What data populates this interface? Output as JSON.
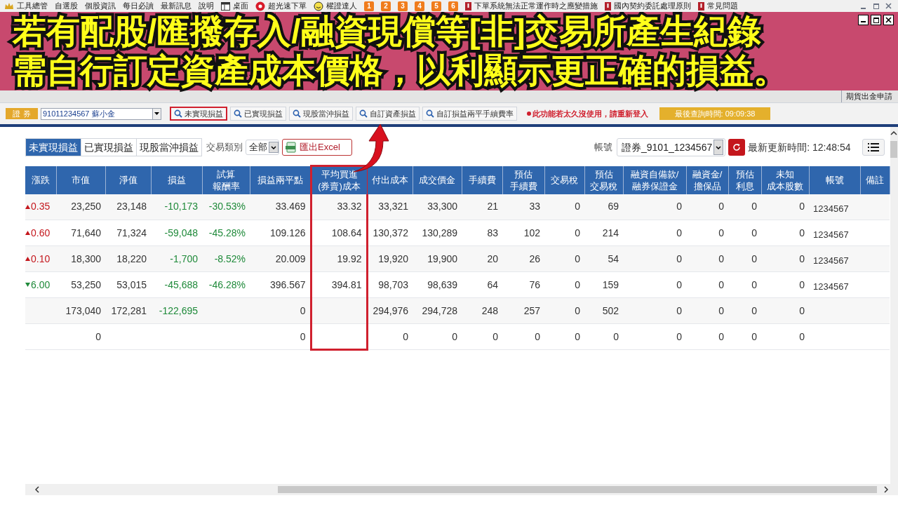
{
  "menu_bar": {
    "items": [
      {
        "label": "工具總管",
        "kind": "crown"
      },
      {
        "label": "自選股",
        "kind": "text"
      },
      {
        "label": "個股資訊",
        "kind": "text"
      },
      {
        "label": "每日必讀",
        "kind": "text"
      },
      {
        "label": "最新訊息",
        "kind": "text"
      },
      {
        "label": "說明",
        "kind": "text"
      },
      {
        "label": "桌面",
        "kind": "window"
      },
      {
        "label": "超光速下單",
        "kind": "burst"
      },
      {
        "label": "權證達人",
        "kind": "smiley"
      },
      {
        "label": "1",
        "kind": "tile"
      },
      {
        "label": "2",
        "kind": "tile"
      },
      {
        "label": "3",
        "kind": "tile"
      },
      {
        "label": "4",
        "kind": "tile"
      },
      {
        "label": "5",
        "kind": "tile"
      },
      {
        "label": "6",
        "kind": "tile"
      },
      {
        "label": "下單系統無法正常運作時之應變措施",
        "kind": "flag"
      },
      {
        "label": "國內契約委託處理原則",
        "kind": "flag"
      },
      {
        "label": "常見問題",
        "kind": "flag"
      }
    ]
  },
  "caption": {
    "lines": [
      "若有配股/匯撥存入/融資現償等[非]交易所產生紀錄",
      "需自行訂定資產成本價格，以利顯示更正確的損益。"
    ]
  },
  "tab_strip": {
    "right_item": "期貨出金申請"
  },
  "toolbar": {
    "market_label": "證 券",
    "account": "91011234567  蘇小金",
    "buttons": [
      {
        "label": "未實現損益",
        "selected": true
      },
      {
        "label": "已實現損益",
        "selected": false
      },
      {
        "label": "現股當沖損益",
        "selected": false
      },
      {
        "label": "自訂資產損益",
        "selected": false
      },
      {
        "label": "自訂損益兩平手續費率",
        "selected": false
      }
    ],
    "warning": "此功能若太久沒使用，請重新登入",
    "last_query": "最後查詢時間:  09:09:38"
  },
  "content": {
    "tabs": [
      {
        "label": "未實現損益",
        "selected": true
      },
      {
        "label": "已實現損益",
        "selected": false
      },
      {
        "label": "現股當沖損益",
        "selected": false
      }
    ],
    "trade_type_label": "交易類別",
    "trade_type": "全部",
    "export_button": "匯出Excel",
    "account_label": "帳號",
    "account": "證券_9101_1234567",
    "updated": "最新更新時間: 12:48:54"
  },
  "table": {
    "columns": [
      {
        "lines": [
          "漲跌"
        ],
        "highlighted": false
      },
      {
        "lines": [
          "市值"
        ],
        "highlighted": false
      },
      {
        "lines": [
          "淨值"
        ],
        "highlighted": false
      },
      {
        "lines": [
          "損益"
        ],
        "highlighted": false
      },
      {
        "lines": [
          "試算",
          "報酬率"
        ],
        "highlighted": false
      },
      {
        "lines": [
          "損益兩平點"
        ],
        "highlighted": false
      },
      {
        "lines": [
          "平均買進",
          "(券賣)成本"
        ],
        "highlighted": true
      },
      {
        "lines": [
          "付出成本"
        ],
        "highlighted": false
      },
      {
        "lines": [
          "成交價金"
        ],
        "highlighted": false
      },
      {
        "lines": [
          "手續費"
        ],
        "highlighted": false
      },
      {
        "lines": [
          "預估",
          "手續費"
        ],
        "highlighted": false
      },
      {
        "lines": [
          "交易稅"
        ],
        "highlighted": false
      },
      {
        "lines": [
          "預估",
          "交易稅"
        ],
        "highlighted": false
      },
      {
        "lines": [
          "融資自備款/",
          "融券保證金"
        ],
        "highlighted": false
      },
      {
        "lines": [
          "融資金/",
          "擔保品"
        ],
        "highlighted": false
      },
      {
        "lines": [
          "預估",
          "利息"
        ],
        "highlighted": false
      },
      {
        "lines": [
          "未知",
          "成本股數"
        ],
        "highlighted": false
      },
      {
        "lines": [
          "帳號"
        ],
        "highlighted": false
      },
      {
        "lines": [
          "備註"
        ],
        "highlighted": false
      }
    ],
    "rows": [
      {
        "loss": true,
        "cells": [
          {
            "kind": "up",
            "value": "0.35"
          },
          "23,250",
          "23,148",
          "-10,173",
          "-30.53%",
          "33.469",
          "33.32",
          "33,321",
          "33,300",
          "21",
          "33",
          "0",
          "69",
          "0",
          "0",
          "0",
          "0",
          "1234567",
          ""
        ]
      },
      {
        "loss": true,
        "cells": [
          {
            "kind": "up",
            "value": "0.60"
          },
          "71,640",
          "71,324",
          "-59,048",
          "-45.28%",
          "109.126",
          "108.64",
          "130,372",
          "130,289",
          "83",
          "102",
          "0",
          "214",
          "0",
          "0",
          "0",
          "0",
          "1234567",
          ""
        ]
      },
      {
        "loss": true,
        "cells": [
          {
            "kind": "up",
            "value": "0.10"
          },
          "18,300",
          "18,220",
          "-1,700",
          "-8.52%",
          "20.009",
          "19.92",
          "19,920",
          "19,900",
          "20",
          "26",
          "0",
          "54",
          "0",
          "0",
          "0",
          "0",
          "1234567",
          ""
        ]
      },
      {
        "loss": true,
        "cells": [
          {
            "kind": "down",
            "value": "6.00"
          },
          "53,250",
          "53,015",
          "-45,688",
          "-46.28%",
          "396.567",
          "394.81",
          "98,703",
          "98,639",
          "64",
          "76",
          "0",
          "159",
          "0",
          "0",
          "0",
          "0",
          "1234567",
          ""
        ]
      },
      {
        "loss": true,
        "cells": [
          "",
          "173,040",
          "172,281",
          "-122,695",
          "",
          "0",
          "",
          "294,976",
          "294,728",
          "248",
          "257",
          "0",
          "502",
          "0",
          "0",
          "0",
          "0",
          "",
          ""
        ]
      },
      {
        "cells": [
          "",
          "0",
          "",
          "",
          "",
          "0",
          "",
          "0",
          "0",
          "0",
          "0",
          "0",
          "0",
          "0",
          "0",
          "0",
          "0",
          "",
          ""
        ]
      }
    ]
  }
}
